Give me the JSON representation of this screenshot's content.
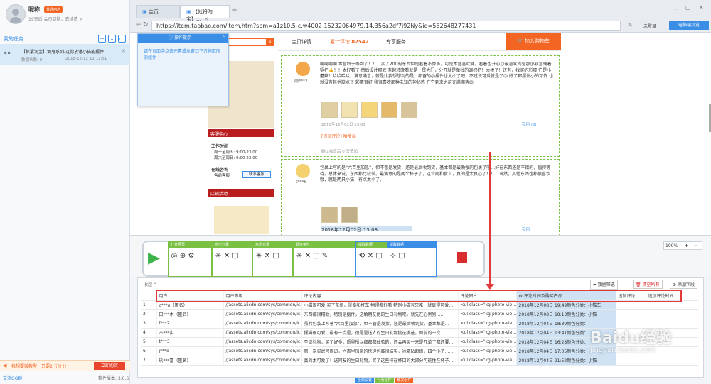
{
  "user": {
    "nickname": "昵称",
    "vip_label": "普通用户",
    "status": "19天后 会员到期，去续费 >"
  },
  "sidebar": {
    "tasks_title": "我的任务",
    "task": {
      "title": "【抓紧淘宝】酒鬼系列-这你放谨小猫能摆件…",
      "subtitle": "数据条数: 0",
      "time": "2018-12-12 11:11:51"
    },
    "promo": "我想要搬教型，只要2 元!! !!",
    "promo_button": "立即购买",
    "footer_left": "交流QQ群",
    "version": "软件版本: 3.0.6"
  },
  "browser": {
    "tabs": [
      "主页",
      "【就将淘宝】…"
    ],
    "url": "https://item.taobao.com/item.htm?spm=a1z10.5-c.w4002-15232064979.14.356a2df7j92Ny&id=562648277431",
    "right_label1": "未登录",
    "right_label2": "电脑端浏览"
  },
  "popup": {
    "title": "操作提示",
    "body": "请在页面中点击元素或从窗口下方拖取所需组件"
  },
  "page": {
    "tabs": [
      "宝贝详情",
      "累计评论",
      "专享服务"
    ],
    "review_count": "82542",
    "add_cart": "加入购物车",
    "shop_service": "客服中心",
    "work_time_label": "工作时间",
    "work_time1": "周一至周五: 9:00-23:00",
    "work_time2": "周六至周日: 9:00-23:00",
    "online_label": "在线咨询",
    "online_item": "售前客服",
    "contact": "联系客服",
    "shop_activity": "店铺活动",
    "reviews": [
      {
        "user": "雨***2",
        "text": "啊啊啊啊 本宫终于等到了！！！买了200的东西但是看着不算多，可是本宫喜欢啊，看着也开心😊最喜欢的是那小软宫铺着锅把👍！！太好看了 然后设计那裤 有起转晚看就是一贯大门，分开就是单独的调把把！大棒了！还有，找买的彩蛋 它是小蘑菇！哈哈哈哈，满意满意，就是比我想想到的是，都留的小摆件也太小了吧，不过说可爱就是了😊 除了都摆件小的可怜 也就没有其他缺点了 彩蛋很好 我很喜欢那种未知的神秘感 在它到来之前充满期待😊",
        "date": "2018年12月02日 13:09",
        "extra": "[追加评论] 哈哈😄",
        "extra_date": "确认收货后 0 天追加",
        "useful": "有用 (5)"
      },
      {
        "user": "t***6",
        "text": "包裹上写的是“六百里加急”，但不管是发货，还是最后收到货，基本都是最晚慢的包裹了吧…好在东西还是不错的，值得等待。总体来说，东西都比较差。最满意的是两个杯子了，这个雨和食工，真的是太良心了！！！当然，其他东西也都很喜欢哦，就是两只小猫，有点太小了。",
        "date": "2018年12月02日 13:08",
        "useful": "有用"
      }
    ]
  },
  "workflow": {
    "steps": [
      "打开网页",
      "点击元素",
      "点击元素",
      "循环条件",
      "提取数据"
    ],
    "zoom": "100%"
  },
  "data_panel": {
    "collapse_label": "收起",
    "filter": "数据筛选",
    "clear": "清空所有",
    "add_field": "添加字段",
    "columns": [
      "用户",
      "用户等级",
      "评论内容",
      "评论图片",
      "评论时间及购买产品",
      "追加评论",
      "追加评论时间"
    ],
    "rows": [
      [
        "c***n（匿名）",
        "//assets.alicdn.com/sys/common/ic…",
        "小猫很可爱 买了花瓶，景泰和杯车 物得都好看 特别小猫有只难一就显得可爱…",
        "<ul class=\"kg-photo-vie…",
        "2018年12月08日 19:49颜色分类：小猫车",
        "",
        ""
      ],
      [
        "口***木（匿名）",
        "//assets.alicdn.com/sys/common/ic…",
        "东西都很精致，特别是摆件，送给朋友她的生日礼物吧，就先在心黑狗……",
        "<ul class=\"kg-photo-vie…",
        "2018年12月08日 18:13颜色分类：小猫",
        "",
        ""
      ],
      [
        "f***2",
        "//assets.alicdn.com/sys/common/ic…",
        "虽然包装上写着“六百里加急”，但不管是发货，还是最后收到货，基本都是…",
        "<ul class=\"kg-photo-vie…",
        "2018年12月04日 18:39颜色分类：",
        "",
        ""
      ],
      [
        "不***实",
        "//assets.alicdn.com/sys/common/ic…",
        "摆猫很可爱，最有一点是，很是是送人的生日礼物挑选挑选，面前的一次……",
        "<ul class=\"kg-photo-vie…",
        "2018年12月04日 13:41颜色分类：",
        "",
        ""
      ],
      [
        "t***3",
        "//assets.alicdn.com/sys/common/ic…",
        "圣诞礼物，买了好多，质量所以都都都体验的，还会再买一来是几单了都还要…",
        "<ul class=\"kg-photo-vie…",
        "2018年12月04日 16:28颜色分类：",
        "",
        ""
      ],
      [
        "j***o",
        "//assets.alicdn.com/sys/common/ic…",
        "第一次买故宫周边，六百里加急的快递包装很结实，冰箱贴超级，四个小子……",
        "<ul class=\"kg-photo-vie…",
        "2018年12月04日 17:05颜色分类：",
        "",
        ""
      ],
      [
        "玖***富（匿名）",
        "//assets.alicdn.com/sys/common/ic…",
        "真的太可爱了！送同友的生日礼物，买了这些排在杯口的大部分可能性在杯子…",
        "<ul class=\"kg-photo-vie…",
        "2018年12月04日 21:52颜色分类：小猫",
        "",
        ""
      ]
    ]
  },
  "bottom_tabs": [
    "全局设置",
    "行为组件",
    "触发组件"
  ],
  "watermark": "Baidu经验",
  "watermark_url": "jingyan.baidu.com"
}
